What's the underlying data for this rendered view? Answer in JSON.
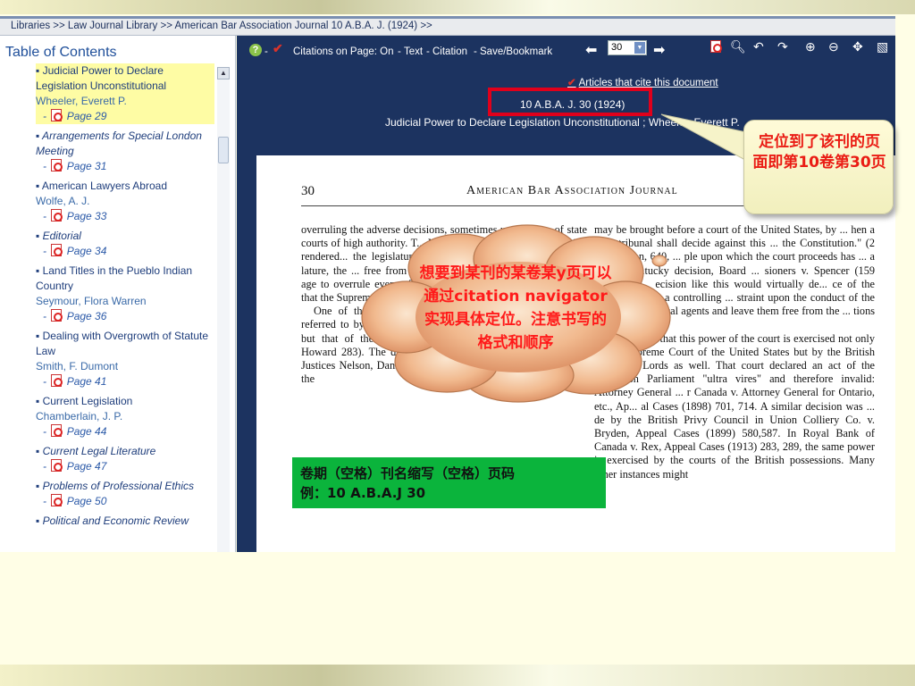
{
  "breadcrumb": "Libraries >> Law Journal Library >> American Bar Association Journal 10 A.B.A. J. (1924) >>",
  "toc": {
    "title": "Table of Contents",
    "items": [
      {
        "title": "Judicial Power to Declare Legislation Unconstitutional",
        "author": "Wheeler, Everett P.",
        "page": "Page 29"
      },
      {
        "title": "Arrangements for Special London Meeting",
        "author": "",
        "page": "Page 31"
      },
      {
        "title": "American Lawyers Abroad",
        "author": "Wolfe, A. J.",
        "page": "Page 33"
      },
      {
        "title": "Editorial",
        "author": "",
        "page": "Page 34"
      },
      {
        "title": "Land Titles in the Pueblo Indian Country",
        "author": "Seymour, Flora Warren",
        "page": "Page 36"
      },
      {
        "title": "Dealing with Overgrowth of Statute Law",
        "author": "Smith, F. Dumont",
        "page": "Page 41"
      },
      {
        "title": "Current Legislation",
        "author": "Chamberlain, J. P.",
        "page": "Page 44"
      },
      {
        "title": "Current Legal Literature",
        "author": "",
        "page": "Page 47"
      },
      {
        "title": "Problems of Professional Ethics",
        "author": "",
        "page": "Page 50"
      },
      {
        "title": "Political and Economic Review",
        "author": "",
        "page": ""
      }
    ]
  },
  "toolbar": {
    "citations_on_page": "Citations on Page: On",
    "text": "Text",
    "citation": "Citation",
    "save_bookmark": "Save/Bookmark",
    "page_value": "30"
  },
  "viewer": {
    "articles_link": "Articles that cite this document",
    "citation": "10 A.B.A. J. 30 (1924)",
    "document_title": "Judicial Power to Declare Legislation Unconstitutional ; Wheeler, Everett P."
  },
  "document": {
    "page_number": "30",
    "running_header": "American Bar Association Journal",
    "left_column": [
      "overruling the adverse decisions, sometimes unanimous, of state courts of high authority. T... M... Clarke's question: H... decision rendered... the legislature of... in many case... of the union... lature, the ... free from do... great jurists,... ciates in Gibbon... age to overrule even... from his Commentaries that he subse... that the Supreme Court was right and he had been wrong.",
      "One of the most notable \"five to four decisions\" is not referred to by Mr. Justice Clarke—that rendered ... New York but that of the supreme judicial court of Massachusetts (7 Howard 283). The dissenting judges, Chief Justice Taney and Justices Nelson, Daniels and Woodbury, all were able men, but the"
    ],
    "right_column": [
      "may be brought before a court of the United States, by ... hen a state tribunal shall decide against this ... the Constitution.\" (2 Richardson, 640, ... ple upon which the court proceeds has ... a recent Kentucky decision, Board ... sioners v. Spencer (159 Kentucky ... ecision like this would virtually de... ce of the Constitution as a controlling ... straint upon the conduct of the people and ... itical agents and leave them free from the ... tions that it imposes.\"",
      "Let me add that this power of the court is exercised not only by the supreme Court of the United States but by the British House of Lords as well. That court declared an act of the Dominion Parliament \"ultra vires\" and therefore invalid: Attorney General ... r Canada v. Attorney General for Ontario, etc., Ap... al Cases (1898) 701, 714. A similar decision was ... de by the British Privy Council in Union Colliery Co. v. Bryden, Appeal Cases (1899) 580,587. In Royal Bank of Canada v. Rex, Appeal Cases (1913) 283, 289, the same power is exercised by the courts of the British possessions. Many other instances might"
    ]
  },
  "annotations": {
    "callout_rect_text": "定位到了该刊的页面即第10卷第30页",
    "cloud_text": "想要到某刊的某卷某y页可以通过citation navigator实现具体定位。注意书写的格式和顺序",
    "green_box_line1": "卷期（空格）刊名缩写（空格）页码",
    "green_box_line2": "例：10 A.B.A.J 30"
  },
  "colors": {
    "viewer_bg": "#1c3360",
    "highlight": "#fefca4",
    "annotation_red": "#ea1c14",
    "green_box": "#0bb43c"
  }
}
